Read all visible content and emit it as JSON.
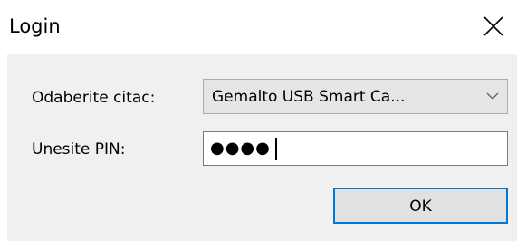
{
  "window": {
    "title": "Login"
  },
  "titlebar": {
    "close_icon": "close-icon"
  },
  "form": {
    "reader_label": "Odaberite citac:",
    "reader_value": "Gemalto USB Smart Ca...",
    "reader_arrow_icon": "chevron-down-icon",
    "pin_label": "Unesite PIN:",
    "pin_value": "●●●●"
  },
  "buttons": {
    "ok_label": "OK"
  },
  "colors": {
    "accent": "#0078d7",
    "dialog_background": "#f0f0f0"
  }
}
